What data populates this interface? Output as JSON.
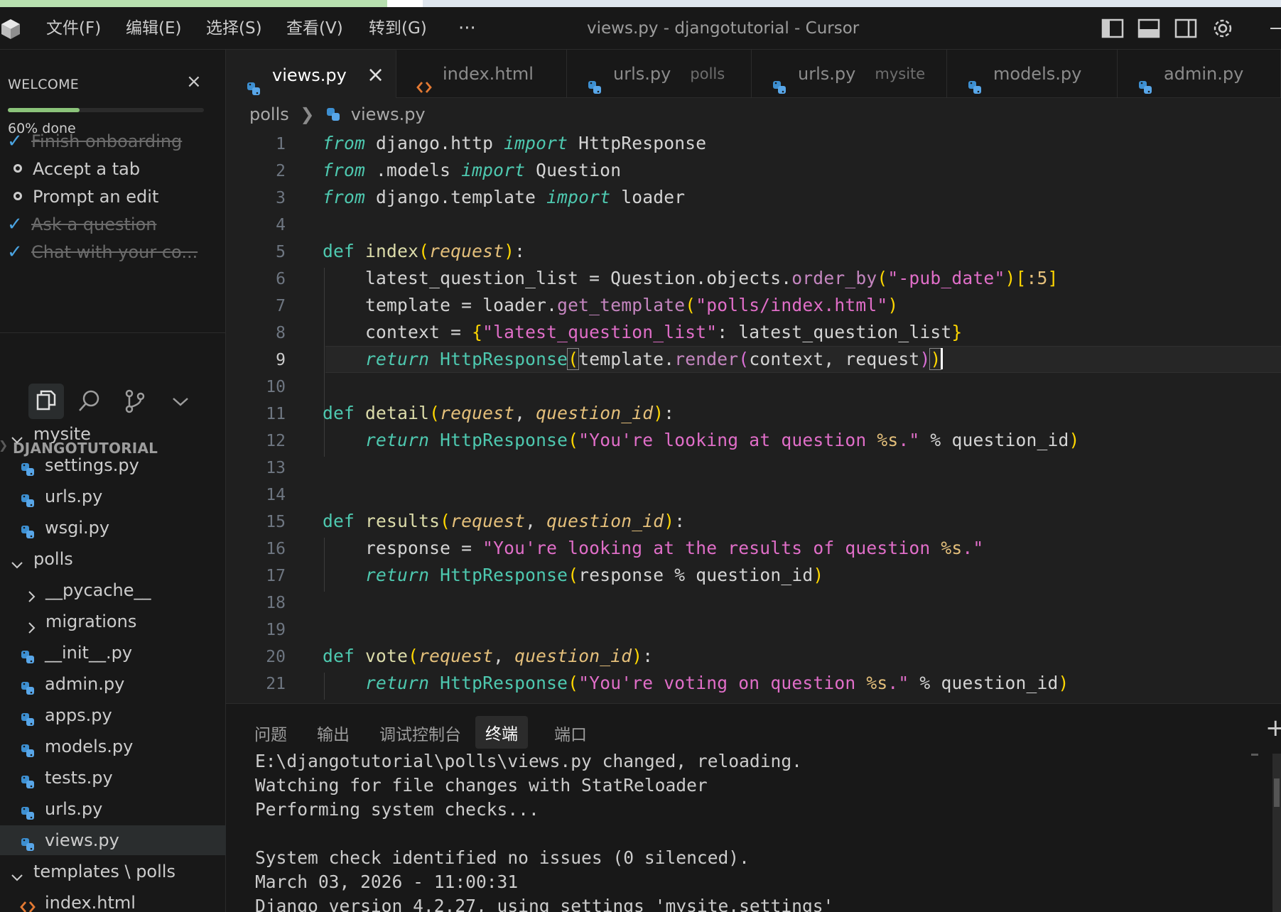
{
  "titlebar": {
    "menus": [
      "文件(F)",
      "编辑(E)",
      "选择(S)",
      "查看(V)",
      "转到(G)"
    ],
    "more": "···",
    "title": "views.py - djangotutorial - Cursor"
  },
  "welcome": {
    "heading": "WELCOME",
    "progress_fraction": 0.6,
    "progress_text": "60% done",
    "tasks": [
      {
        "label": "Finish onboarding",
        "done": true
      },
      {
        "label": "Accept a tab",
        "done": false
      },
      {
        "label": "Prompt an edit",
        "done": false
      },
      {
        "label": "Ask a question",
        "done": true
      },
      {
        "label": "Chat with your co...",
        "done": true
      }
    ]
  },
  "explorer": {
    "section": "DJANGOTUTORIAL",
    "items": [
      {
        "label": "mysite",
        "kind": "folder-open"
      },
      {
        "label": "settings.py",
        "kind": "python"
      },
      {
        "label": "urls.py",
        "kind": "python"
      },
      {
        "label": "wsgi.py",
        "kind": "python"
      },
      {
        "label": "polls",
        "kind": "folder-open"
      },
      {
        "label": "__pycache__",
        "kind": "folder-closed"
      },
      {
        "label": "migrations",
        "kind": "folder-closed"
      },
      {
        "label": "__init__.py",
        "kind": "python"
      },
      {
        "label": "admin.py",
        "kind": "python"
      },
      {
        "label": "apps.py",
        "kind": "python"
      },
      {
        "label": "models.py",
        "kind": "python"
      },
      {
        "label": "tests.py",
        "kind": "python"
      },
      {
        "label": "urls.py",
        "kind": "python"
      },
      {
        "label": "views.py",
        "kind": "python",
        "selected": true
      },
      {
        "label": "templates \\ polls",
        "kind": "folder-open"
      },
      {
        "label": "index.html",
        "kind": "html"
      }
    ]
  },
  "tabs": [
    {
      "label": "views.py",
      "desc": "",
      "kind": "python",
      "active": true
    },
    {
      "label": "index.html",
      "desc": "",
      "kind": "html"
    },
    {
      "label": "urls.py",
      "desc": "polls",
      "kind": "python"
    },
    {
      "label": "urls.py",
      "desc": "mysite",
      "kind": "python"
    },
    {
      "label": "models.py",
      "desc": "",
      "kind": "python"
    },
    {
      "label": "admin.py",
      "desc": "",
      "kind": "python"
    }
  ],
  "breadcrumb": {
    "folder": "polls",
    "file": "views.py"
  },
  "editor": {
    "current_line": 9,
    "line_numbers": [
      "1",
      "2",
      "3",
      "4",
      "5",
      "6",
      "7",
      "8",
      "9",
      "10",
      "11",
      "12",
      "13",
      "14",
      "15",
      "16",
      "17",
      "18",
      "19",
      "20",
      "21"
    ]
  },
  "panel": {
    "tabs": [
      "问题",
      "输出",
      "调试控制台",
      "终端",
      "端口"
    ],
    "active_tab": "终端",
    "terminal_lines": [
      "E:\\djangotutorial\\polls\\views.py changed, reloading.",
      "Watching for file changes with StatReloader",
      "Performing system checks...",
      "",
      "System check identified no issues (0 silenced).",
      "March 03, 2026 - 11:00:31",
      "Django version 4.2.27, using settings 'mysite.settings'"
    ]
  },
  "colors": {
    "accent": "#4aa3e0",
    "progress": "#8bc37a",
    "background": "#1f1f1f",
    "sidebar": "#181818"
  }
}
